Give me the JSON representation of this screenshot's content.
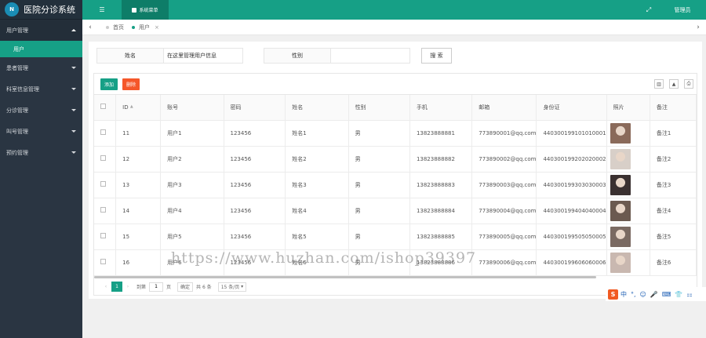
{
  "app": {
    "title": "医院分诊系统",
    "logo_text": "N"
  },
  "sidebar": {
    "groups": [
      {
        "label": "用户管理",
        "open": true,
        "children": [
          {
            "label": "用户"
          }
        ]
      },
      {
        "label": "患者管理"
      },
      {
        "label": "科室信息管理"
      },
      {
        "label": "分诊管理"
      },
      {
        "label": "叫号管理"
      },
      {
        "label": "预约管理"
      }
    ]
  },
  "topbar": {
    "menu_icon": "☰",
    "active_tab": "系统菜单",
    "expand_icon": "⤢",
    "admin_label": "管理员"
  },
  "tabs": [
    {
      "label": "首页",
      "active": false
    },
    {
      "label": "用户",
      "active": true,
      "close": "×"
    }
  ],
  "search": {
    "name_label": "姓名",
    "name_value": "在这里管理用户信息",
    "gender_label": "性别",
    "gender_value": "",
    "button": "搜 索"
  },
  "toolbar": {
    "add": "添加",
    "delete": "删除",
    "icons": [
      "columns-icon",
      "print-icon",
      "export-icon"
    ]
  },
  "table": {
    "columns": [
      "ID",
      "账号",
      "密码",
      "姓名",
      "性别",
      "手机",
      "邮箱",
      "身份证",
      "照片",
      "备注"
    ],
    "rows": [
      {
        "id": "11",
        "account": "用户1",
        "password": "123456",
        "name": "姓名1",
        "gender": "男",
        "phone": "13823888881",
        "email": "773890001@qq.com",
        "idcard": "440300199101010001",
        "remark": "备注1"
      },
      {
        "id": "12",
        "account": "用户2",
        "password": "123456",
        "name": "姓名2",
        "gender": "男",
        "phone": "13823888882",
        "email": "773890002@qq.com",
        "idcard": "440300199202020002",
        "remark": "备注2"
      },
      {
        "id": "13",
        "account": "用户3",
        "password": "123456",
        "name": "姓名3",
        "gender": "男",
        "phone": "13823888883",
        "email": "773890003@qq.com",
        "idcard": "440300199303030003",
        "remark": "备注3"
      },
      {
        "id": "14",
        "account": "用户4",
        "password": "123456",
        "name": "姓名4",
        "gender": "男",
        "phone": "13823888884",
        "email": "773890004@qq.com",
        "idcard": "440300199404040004",
        "remark": "备注4"
      },
      {
        "id": "15",
        "account": "用户5",
        "password": "123456",
        "name": "姓名5",
        "gender": "男",
        "phone": "13823888885",
        "email": "773890005@qq.com",
        "idcard": "440300199505050005",
        "remark": "备注5"
      },
      {
        "id": "16",
        "account": "用户6",
        "password": "123456",
        "name": "姓名6",
        "gender": "男",
        "phone": "13823888886",
        "email": "773890006@qq.com",
        "idcard": "440300199606060006",
        "remark": "备注6"
      }
    ]
  },
  "pager": {
    "prev": "‹",
    "current": "1",
    "next": "›",
    "goto_label": "到第",
    "page_input": "1",
    "page_suffix": "页",
    "go": "确定",
    "total": "共 6 条",
    "page_size": "15 条/页"
  },
  "watermark": "https://www.huzhan.com/ishop39397",
  "ime": {
    "logo": "S",
    "lang": "中",
    "items": [
      "°,",
      "☺",
      "🎤",
      "⌨",
      "👕",
      "⚏"
    ]
  },
  "colors": {
    "accent": "#16a086",
    "sidebar": "#2a3542",
    "danger": "#f5572a"
  }
}
